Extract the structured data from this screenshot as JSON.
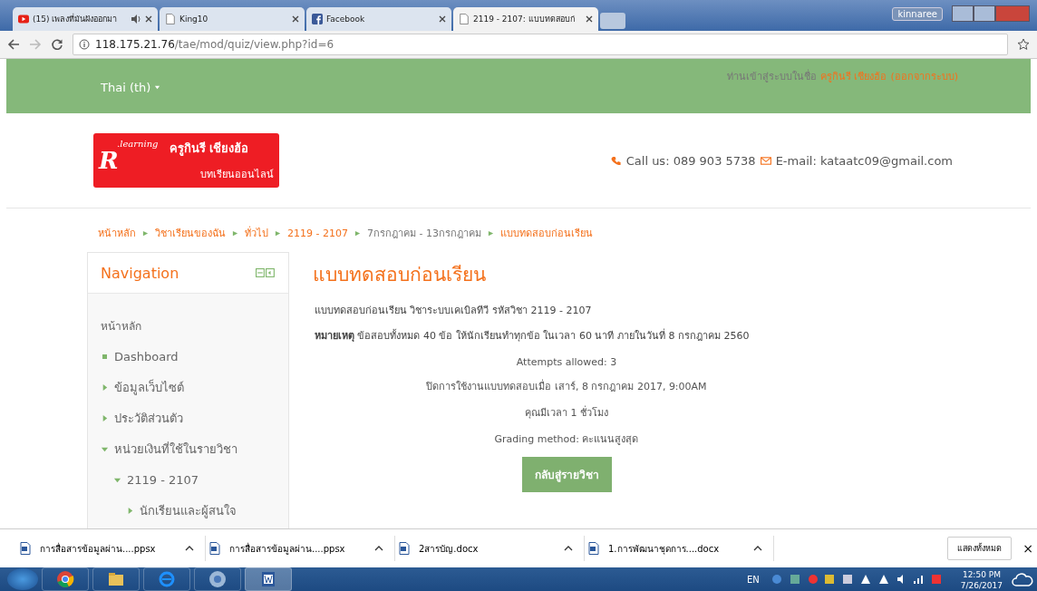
{
  "browser": {
    "tabs": [
      {
        "title": "(15) เพลงที่มันฝังออกมา",
        "kind": "video",
        "audio": true,
        "selected": false
      },
      {
        "title": "King10",
        "kind": "page",
        "audio": false,
        "selected": false
      },
      {
        "title": "Facebook",
        "kind": "facebook",
        "audio": false,
        "selected": false
      },
      {
        "title": "2119 - 2107: แบบทดสอบก่",
        "kind": "page",
        "audio": false,
        "selected": true
      }
    ],
    "user": "kinnaree",
    "url_host": "118.175.21.76",
    "url_path": "/tae/mod/quiz/view.php?id=6"
  },
  "header": {
    "language": "Thai (th)",
    "login_prefix": "ท่านเข้าสู่ระบบในชื่อ",
    "user_name": "ครูกินรี เชียงฮ้อ",
    "logout": "(ออกจากระบบ)"
  },
  "logo": {
    "letter": "R",
    "brand": ".learning",
    "owner": "ครูกินรี เชียงฮ้อ",
    "tagline": "บทเรียนออนไลน์"
  },
  "contact": {
    "phone": "Call us: 089 903 5738",
    "email": "E-mail: kataatc09@gmail.com"
  },
  "breadcrumb": [
    {
      "label": "หน้าหลัก",
      "link": true
    },
    {
      "label": "วิชาเรียนของฉัน",
      "link": true
    },
    {
      "label": "ทั่วไป",
      "link": true
    },
    {
      "label": "2119 - 2107",
      "link": true
    },
    {
      "label": "7กรกฎาคม - 13กรกฎาคม",
      "link": false
    },
    {
      "label": "แบบทดสอบก่อนเรียน",
      "link": true
    }
  ],
  "navigation": {
    "title": "Navigation",
    "items": [
      {
        "label": "หน้าหลัก",
        "kind": "plain"
      },
      {
        "label": "Dashboard",
        "kind": "leaf"
      },
      {
        "label": "ข้อมูลเว็บไซต์",
        "kind": "branch",
        "expanded": false
      },
      {
        "label": "ประวัติส่วนตัว",
        "kind": "branch",
        "expanded": false
      },
      {
        "label": "หน่วยเงินที่ใช้ในรายวิชา",
        "kind": "branch",
        "expanded": true,
        "children": [
          {
            "label": "2119 - 2107",
            "kind": "branch",
            "expanded": true,
            "children": [
              {
                "label": "นักเรียนและผู้สนใจ",
                "kind": "branch",
                "expanded": false
              }
            ]
          }
        ]
      }
    ]
  },
  "quiz": {
    "title": "แบบทดสอบก่อนเรียน",
    "intro": "แบบทดสอบก่อนเรียน วิชาระบบเคเบิลทีวี รหัสวิชา 2119 - 2107",
    "note": "**หมายเหตุ** ข้อสอบทั้งหมด 40 ข้อ ให้นักเรียนทำทุกข้อ ในเวลา 60 นาที ภายในวันที่ 8 กรกฎาคม 2560",
    "info": [
      "Attempts allowed: 3",
      "ปิดการใช้งานแบบทดสอบเมื่อ เสาร์, 8 กรกฎาคม 2017, 9:00AM",
      "คุณมีเวลา 1 ชั่วโมง",
      "Grading method: คะแนนสูงสุด"
    ],
    "button": "กลับสู่รายวิชา"
  },
  "downloads": {
    "items": [
      "การสื่อสารข้อมูลผ่าน....ppsx",
      "การสื่อสารข้อมูลผ่าน....ppsx",
      "2สารบัญ.docx",
      "1.การพัฒนาชุดการ....docx"
    ],
    "show_all": "แสดงทั้งหมด",
    "close": "×"
  },
  "taskbar": {
    "language": "EN",
    "time": "12:50 PM",
    "date": "7/26/2017"
  }
}
